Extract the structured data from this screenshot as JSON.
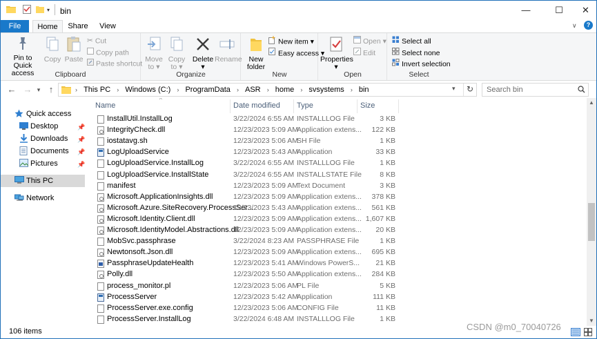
{
  "window": {
    "title": "bin",
    "minimize_glyph": "—",
    "maximize_glyph": "☐",
    "close_glyph": "✕"
  },
  "ribbon": {
    "tabs": [
      "File",
      "Home",
      "Share",
      "View"
    ],
    "clipboard": {
      "label": "Clipboard",
      "pin_line1": "Pin to Quick",
      "pin_line2": "access",
      "copy": "Copy",
      "paste": "Paste",
      "cut": "Cut",
      "copy_path": "Copy path",
      "paste_shortcut": "Paste shortcut"
    },
    "organize": {
      "label": "Organize",
      "move_to_line1": "Move",
      "move_to_line2": "to ▾",
      "copy_to_line1": "Copy",
      "copy_to_line2": "to ▾",
      "delete_line1": "Delete",
      "delete_line2": "▾",
      "rename": "Rename"
    },
    "new": {
      "label": "New",
      "new_folder_line1": "New",
      "new_folder_line2": "folder",
      "new_item": "New item ▾",
      "easy_access": "Easy access ▾"
    },
    "open": {
      "label": "Open",
      "properties_line1": "Properties",
      "properties_line2": "▾",
      "open": "Open ▾",
      "edit": "Edit"
    },
    "select": {
      "label": "Select",
      "select_all": "Select all",
      "select_none": "Select none",
      "invert_selection": "Invert selection"
    }
  },
  "address": {
    "breadcrumbs": [
      "This PC",
      "Windows (C:)",
      "ProgramData",
      "ASR",
      "home",
      "svsystems",
      "bin"
    ],
    "search_placeholder": "Search bin",
    "back_glyph": "←",
    "forward_glyph": "→",
    "history_glyph": "▾",
    "up_glyph": "↑",
    "dropdown_glyph": "▾",
    "refresh_glyph": "↻"
  },
  "navpane": {
    "quick_access": "Quick access",
    "items": [
      "Desktop",
      "Downloads",
      "Documents",
      "Pictures"
    ],
    "this_pc": "This PC",
    "network": "Network"
  },
  "columns": {
    "name": "Name",
    "date_modified": "Date modified",
    "type": "Type",
    "size": "Size"
  },
  "files": [
    {
      "name": "InstallUtil.InstallLog",
      "date": "3/22/2024 6:55 AM",
      "type": "INSTALLLOG File",
      "size": "3 KB",
      "icon": "file"
    },
    {
      "name": "IntegrityCheck.dll",
      "date": "12/23/2023 5:09 AM",
      "type": "Application extens...",
      "size": "122 KB",
      "icon": "dll"
    },
    {
      "name": "iostatavg.sh",
      "date": "12/23/2023 5:06 AM",
      "type": "SH File",
      "size": "1 KB",
      "icon": "file"
    },
    {
      "name": "LogUploadService",
      "date": "12/23/2023 5:43 AM",
      "type": "Application",
      "size": "33 KB",
      "icon": "app"
    },
    {
      "name": "LogUploadService.InstallLog",
      "date": "3/22/2024 6:55 AM",
      "type": "INSTALLLOG File",
      "size": "1 KB",
      "icon": "file"
    },
    {
      "name": "LogUploadService.InstallState",
      "date": "3/22/2024 6:55 AM",
      "type": "INSTALLSTATE File",
      "size": "8 KB",
      "icon": "file"
    },
    {
      "name": "manifest",
      "date": "12/23/2023 5:09 AM",
      "type": "Text Document",
      "size": "3 KB",
      "icon": "file"
    },
    {
      "name": "Microsoft.ApplicationInsights.dll",
      "date": "12/23/2023 5:09 AM",
      "type": "Application extens...",
      "size": "378 KB",
      "icon": "dll"
    },
    {
      "name": "Microsoft.Azure.SiteRecovery.ProcessSer...",
      "date": "12/23/2023 5:43 AM",
      "type": "Application extens...",
      "size": "561 KB",
      "icon": "dll"
    },
    {
      "name": "Microsoft.Identity.Client.dll",
      "date": "12/23/2023 5:09 AM",
      "type": "Application extens...",
      "size": "1,607 KB",
      "icon": "dll"
    },
    {
      "name": "Microsoft.IdentityModel.Abstractions.dll",
      "date": "12/23/2023 5:09 AM",
      "type": "Application extens...",
      "size": "20 KB",
      "icon": "dll"
    },
    {
      "name": "MobSvc.passphrase",
      "date": "3/22/2024 8:23 AM",
      "type": "PASSPHRASE File",
      "size": "1 KB",
      "icon": "file"
    },
    {
      "name": "Newtonsoft.Json.dll",
      "date": "12/23/2023 5:09 AM",
      "type": "Application extens...",
      "size": "695 KB",
      "icon": "dll"
    },
    {
      "name": "PassphraseUpdateHealth",
      "date": "12/23/2023 5:41 AM",
      "type": "Windows PowerS...",
      "size": "21 KB",
      "icon": "ps"
    },
    {
      "name": "Polly.dll",
      "date": "12/23/2023 5:50 AM",
      "type": "Application extens...",
      "size": "284 KB",
      "icon": "dll"
    },
    {
      "name": "process_monitor.pl",
      "date": "12/23/2023 5:06 AM",
      "type": "PL File",
      "size": "5 KB",
      "icon": "file"
    },
    {
      "name": "ProcessServer",
      "date": "12/23/2023 5:42 AM",
      "type": "Application",
      "size": "111 KB",
      "icon": "app"
    },
    {
      "name": "ProcessServer.exe.config",
      "date": "12/23/2023 5:06 AM",
      "type": "CONFIG File",
      "size": "11 KB",
      "icon": "file"
    },
    {
      "name": "ProcessServer.InstallLog",
      "date": "3/22/2024 6:48 AM",
      "type": "INSTALLLOG File",
      "size": "1 KB",
      "icon": "file"
    }
  ],
  "status": {
    "item_count": "106 items"
  },
  "watermark": "CSDN @m0_70040726"
}
